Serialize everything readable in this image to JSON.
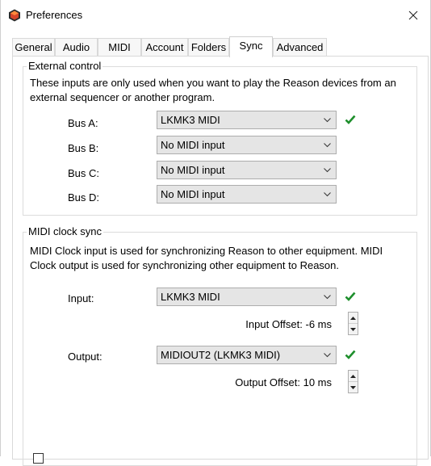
{
  "window": {
    "title": "Preferences",
    "close_icon": "close-icon"
  },
  "tabs": [
    {
      "label": "General"
    },
    {
      "label": "Audio"
    },
    {
      "label": "MIDI"
    },
    {
      "label": "Account"
    },
    {
      "label": "Folders"
    },
    {
      "label": "Sync",
      "active": true
    },
    {
      "label": "Advanced"
    }
  ],
  "external_control": {
    "title": "External control",
    "description_line1": "These inputs are only used when you want to play the Reason devices from an",
    "description_line2": "external sequencer or another program.",
    "buses": [
      {
        "label": "Bus A:",
        "value": "LKMK3 MIDI",
        "ok": true
      },
      {
        "label": "Bus B:",
        "value": "No MIDI input",
        "ok": false
      },
      {
        "label": "Bus C:",
        "value": "No MIDI input",
        "ok": false
      },
      {
        "label": "Bus D:",
        "value": "No MIDI input",
        "ok": false
      }
    ]
  },
  "midi_clock_sync": {
    "title": "MIDI clock sync",
    "description_line1": "MIDI Clock input is used for synchronizing Reason to other equipment. MIDI",
    "description_line2": "Clock output is used for synchronizing other equipment to Reason.",
    "input_label": "Input:",
    "input_value": "LKMK3 MIDI",
    "input_offset": "Input Offset: -6 ms",
    "output_label": "Output:",
    "output_value": "MIDIOUT2 (LKMK3 MIDI)",
    "output_offset": "Output Offset: 10 ms"
  },
  "colors": {
    "check_green": "#1e8f2c",
    "app_icon": "#c8321e"
  }
}
